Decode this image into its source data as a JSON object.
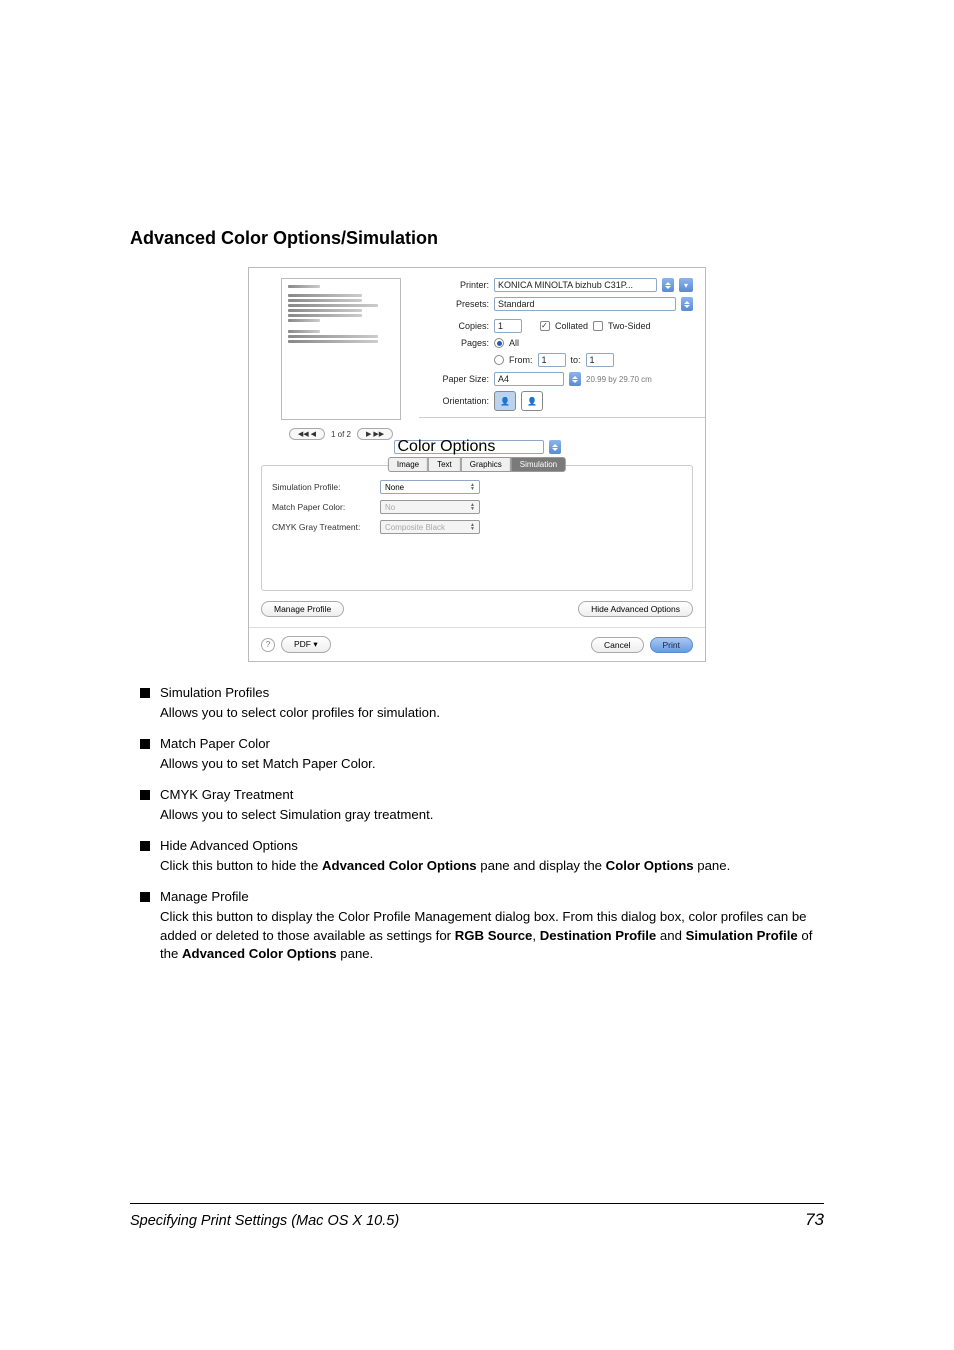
{
  "heading": "Advanced Color Options/Simulation",
  "dialog": {
    "printer_label": "Printer:",
    "printer_value": "KONICA MINOLTA bizhub C31P...",
    "presets_label": "Presets:",
    "presets_value": "Standard",
    "copies_label": "Copies:",
    "copies_value": "1",
    "collated": "Collated",
    "two_sided": "Two-Sided",
    "pages_label": "Pages:",
    "pages_all": "All",
    "pages_from": "From:",
    "pages_from_v": "1",
    "pages_to": "to:",
    "pages_to_v": "1",
    "papersize_label": "Paper Size:",
    "papersize_value": "A4",
    "papersize_dim": "20.99 by 29.70 cm",
    "orientation_label": "Orientation:",
    "section_value": "Color Options",
    "tab_image": "Image",
    "tab_text": "Text",
    "tab_graphics": "Graphics",
    "tab_simulation": "Simulation",
    "sim_profile_l": "Simulation Profile:",
    "sim_profile_v": "None",
    "match_l": "Match Paper Color:",
    "match_v": "No",
    "cmyk_l": "CMYK Gray Treatment:",
    "cmyk_v": "Composite Black",
    "manage_profile": "Manage Profile",
    "hide_adv": "Hide Advanced Options",
    "pdf": "PDF ▾",
    "cancel": "Cancel",
    "print": "Print",
    "pager": "1 of 2",
    "pager_l": "◀◀    ◀",
    "pager_r": "▶    ▶▶"
  },
  "items": [
    {
      "title": "Simulation Profiles",
      "desc": "Allows you to select color profiles for simulation."
    },
    {
      "title": "Match Paper Color",
      "desc": "Allows you to set Match Paper Color."
    },
    {
      "title": "CMYK Gray Treatment",
      "desc": "Allows you to select Simulation gray treatment."
    },
    {
      "title": "Hide Advanced Options",
      "desc_pre": "Click this button to hide the ",
      "bold1": "Advanced Color Options",
      "desc_mid": " pane and display the ",
      "bold2": "Color Options",
      "desc_post": " pane."
    },
    {
      "title": "Manage Profile",
      "desc_pre": "Click this button to display the Color Profile Management dialog box. From this dialog box, color profiles can be added or deleted to those available as settings for ",
      "bold1": "RGB Source",
      "sep1": ", ",
      "bold2": "Destination Profile",
      "sep2": " and ",
      "bold3": "Simulation Profile",
      "desc_mid": " of the ",
      "bold4": "Advanced Color Options",
      "desc_post": " pane."
    }
  ],
  "footer": {
    "left": "Specifying Print Settings (Mac OS X 10.5)",
    "right": "73"
  }
}
